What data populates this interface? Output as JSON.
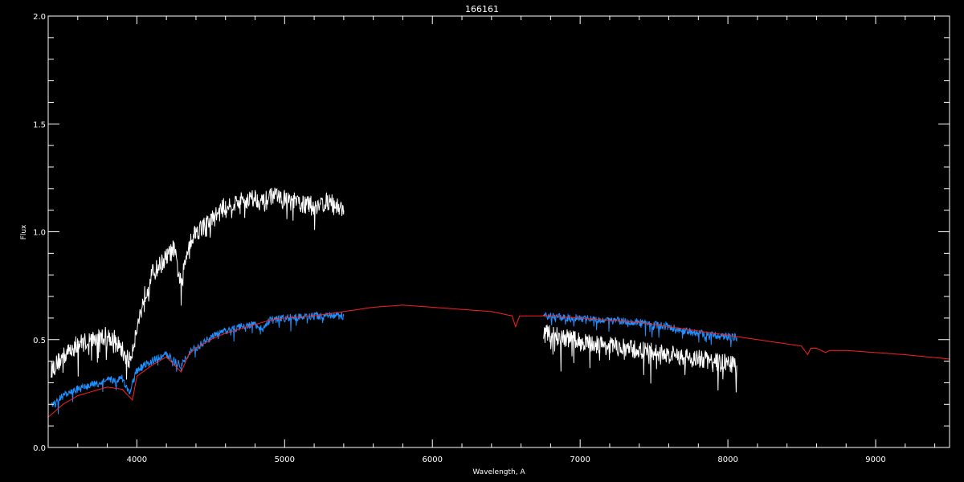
{
  "chart_data": {
    "type": "line",
    "title": "166161",
    "xlabel": "Wavelength, A",
    "ylabel": "Flux",
    "xlim": [
      3400,
      9500
    ],
    "ylim": [
      0.0,
      2.0
    ],
    "xticks": [
      4000,
      5000,
      6000,
      7000,
      8000,
      9000
    ],
    "xtick_labels": [
      "4000",
      "5000",
      "6000",
      "7000",
      "8000",
      "9000"
    ],
    "yticks": [
      0.0,
      0.5,
      1.0,
      1.5,
      2.0
    ],
    "ytick_labels": [
      "0.0",
      "0.5",
      "1.0",
      "1.5",
      "2.0"
    ],
    "grid": false,
    "background": "#000000",
    "foreground": "#ffffff",
    "series": [
      {
        "color": "#ffffff",
        "noise": 0.045,
        "segments": [
          [
            [
              3420,
              0.36
            ],
            [
              3500,
              0.42
            ],
            [
              3600,
              0.48
            ],
            [
              3700,
              0.5
            ],
            [
              3800,
              0.52
            ],
            [
              3850,
              0.5
            ],
            [
              3900,
              0.45
            ],
            [
              3950,
              0.4
            ],
            [
              4000,
              0.55
            ],
            [
              4050,
              0.7
            ],
            [
              4100,
              0.8
            ],
            [
              4200,
              0.88
            ],
            [
              4250,
              0.92
            ],
            [
              4300,
              0.75
            ],
            [
              4350,
              0.95
            ],
            [
              4400,
              1.0
            ],
            [
              4500,
              1.05
            ],
            [
              4600,
              1.12
            ],
            [
              4700,
              1.14
            ],
            [
              4800,
              1.16
            ],
            [
              4860,
              1.13
            ],
            [
              4900,
              1.17
            ],
            [
              5000,
              1.15
            ],
            [
              5100,
              1.13
            ],
            [
              5200,
              1.12
            ],
            [
              5300,
              1.14
            ],
            [
              5400,
              1.1
            ]
          ],
          [
            [
              6750,
              0.53
            ],
            [
              6900,
              0.51
            ],
            [
              7000,
              0.49
            ],
            [
              7200,
              0.47
            ],
            [
              7400,
              0.45
            ],
            [
              7600,
              0.43
            ],
            [
              7700,
              0.42
            ],
            [
              7800,
              0.41
            ],
            [
              7900,
              0.4
            ],
            [
              8060,
              0.38
            ]
          ]
        ]
      },
      {
        "color": "#1e90ff",
        "noise": 0.018,
        "segments": [
          [
            [
              3420,
              0.19
            ],
            [
              3500,
              0.24
            ],
            [
              3600,
              0.27
            ],
            [
              3700,
              0.29
            ],
            [
              3800,
              0.31
            ],
            [
              3900,
              0.32
            ],
            [
              3950,
              0.25
            ],
            [
              4000,
              0.36
            ],
            [
              4100,
              0.4
            ],
            [
              4200,
              0.43
            ],
            [
              4300,
              0.38
            ],
            [
              4350,
              0.44
            ],
            [
              4400,
              0.46
            ],
            [
              4500,
              0.51
            ],
            [
              4600,
              0.54
            ],
            [
              4700,
              0.56
            ],
            [
              4800,
              0.57
            ],
            [
              4860,
              0.55
            ],
            [
              4900,
              0.59
            ],
            [
              5000,
              0.6
            ],
            [
              5200,
              0.61
            ],
            [
              5400,
              0.61
            ]
          ],
          [
            [
              6750,
              0.61
            ],
            [
              6900,
              0.6
            ],
            [
              7000,
              0.6
            ],
            [
              7200,
              0.59
            ],
            [
              7400,
              0.58
            ],
            [
              7500,
              0.57
            ],
            [
              7600,
              0.56
            ],
            [
              7700,
              0.54
            ],
            [
              7800,
              0.53
            ],
            [
              7900,
              0.52
            ],
            [
              8060,
              0.51
            ]
          ]
        ]
      },
      {
        "color": "#ff2020",
        "noise": 0.0,
        "segments": [
          [
            [
              3400,
              0.14
            ],
            [
              3500,
              0.2
            ],
            [
              3600,
              0.24
            ],
            [
              3700,
              0.26
            ],
            [
              3800,
              0.28
            ],
            [
              3900,
              0.27
            ],
            [
              3970,
              0.22
            ],
            [
              4000,
              0.33
            ],
            [
              4100,
              0.38
            ],
            [
              4200,
              0.42
            ],
            [
              4300,
              0.35
            ],
            [
              4350,
              0.43
            ],
            [
              4400,
              0.46
            ],
            [
              4500,
              0.5
            ],
            [
              4600,
              0.53
            ],
            [
              4700,
              0.55
            ],
            [
              4800,
              0.57
            ],
            [
              4900,
              0.59
            ],
            [
              5000,
              0.6
            ],
            [
              5200,
              0.61
            ],
            [
              5400,
              0.63
            ],
            [
              5600,
              0.65
            ],
            [
              5800,
              0.66
            ],
            [
              6000,
              0.65
            ],
            [
              6200,
              0.64
            ],
            [
              6400,
              0.63
            ],
            [
              6540,
              0.61
            ],
            [
              6563,
              0.56
            ],
            [
              6590,
              0.61
            ],
            [
              6800,
              0.61
            ],
            [
              7000,
              0.6
            ],
            [
              7200,
              0.59
            ],
            [
              7400,
              0.58
            ],
            [
              7600,
              0.56
            ],
            [
              7800,
              0.54
            ],
            [
              8000,
              0.52
            ],
            [
              8200,
              0.5
            ],
            [
              8400,
              0.48
            ],
            [
              8498,
              0.47
            ],
            [
              8540,
              0.43
            ],
            [
              8560,
              0.46
            ],
            [
              8600,
              0.46
            ],
            [
              8662,
              0.44
            ],
            [
              8690,
              0.45
            ],
            [
              8800,
              0.45
            ],
            [
              9000,
              0.44
            ],
            [
              9200,
              0.43
            ],
            [
              9500,
              0.41
            ]
          ]
        ]
      },
      {
        "color": "#1e90ff",
        "noise": 0.0,
        "segments": [
          [
            [
              3420,
              0.0
            ],
            [
              5400,
              0.0
            ]
          ],
          [
            [
              6750,
              0.0
            ],
            [
              8060,
              0.0
            ]
          ]
        ]
      }
    ]
  }
}
